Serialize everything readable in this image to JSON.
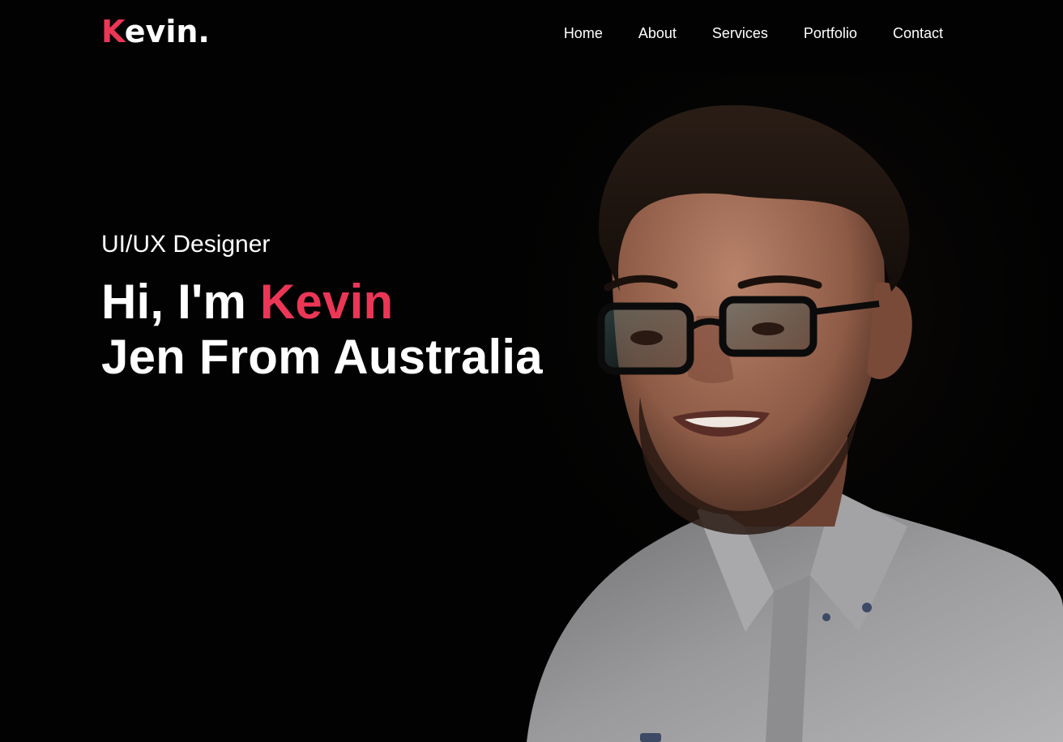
{
  "brand": {
    "logo_first": "K",
    "logo_rest": "evin."
  },
  "nav": {
    "items": [
      {
        "label": "Home"
      },
      {
        "label": "About"
      },
      {
        "label": "Services"
      },
      {
        "label": "Portfolio"
      },
      {
        "label": "Contact"
      }
    ]
  },
  "hero": {
    "role": "UI/UX Designer",
    "greeting": "Hi, I'm",
    "name": "Kevin",
    "line2": "Jen From Australia"
  },
  "colors": {
    "accent": "#eb3656",
    "background": "#000000",
    "text": "#ffffff"
  }
}
